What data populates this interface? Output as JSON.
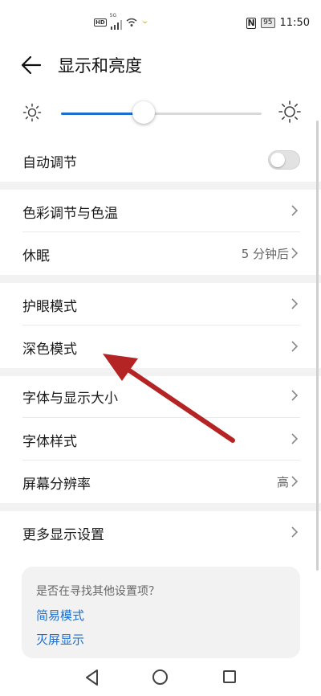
{
  "status": {
    "network": "5G",
    "hd_badge": "HD",
    "battery": "95",
    "time": "11:50",
    "nfc": "N"
  },
  "header": {
    "title": "显示和亮度"
  },
  "brightness": {
    "level_fraction": 0.41
  },
  "auto_adjust": {
    "label": "自动调节",
    "enabled": false
  },
  "items": [
    {
      "label": "色彩调节与色温",
      "value": ""
    },
    {
      "label": "休眠",
      "value": "5 分钟后"
    },
    {
      "label": "护眼模式",
      "value": ""
    },
    {
      "label": "深色模式",
      "value": ""
    },
    {
      "label": "字体与显示大小",
      "value": ""
    },
    {
      "label": "字体样式",
      "value": ""
    },
    {
      "label": "屏幕分辨率",
      "value": "高"
    },
    {
      "label": "更多显示设置",
      "value": ""
    }
  ],
  "suggestion": {
    "question": "是否在寻找其他设置项？",
    "links": [
      "简易模式",
      "灭屏显示"
    ]
  },
  "colors": {
    "accent": "#1c6fd1",
    "annotation_arrow": "#b52424"
  },
  "icons": [
    "back-arrow-icon",
    "sun-small-icon",
    "sun-large-icon",
    "chevron-right-icon",
    "nav-back-icon",
    "nav-home-icon",
    "nav-recent-icon"
  ]
}
